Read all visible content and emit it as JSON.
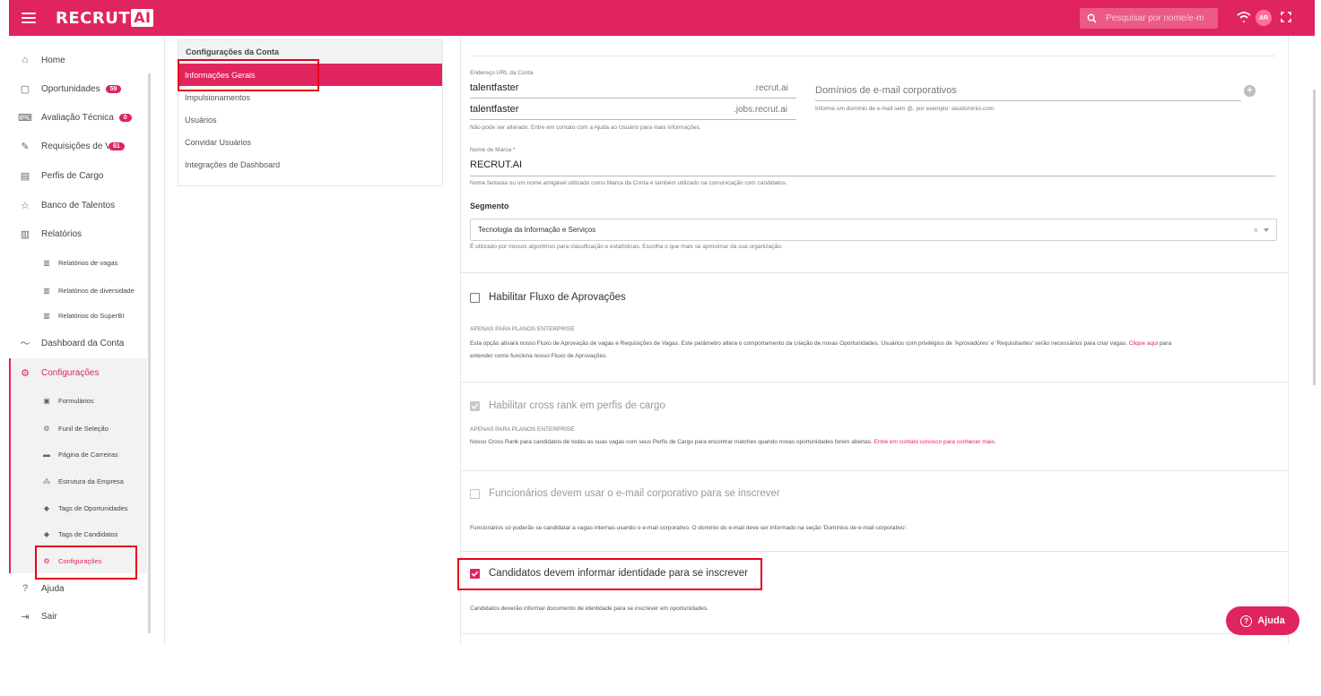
{
  "header": {
    "logo_text": "RECRUT",
    "logo_ai": "AI",
    "search_placeholder": "Pesquisar por nome/e-m",
    "avatar_initials": "AR"
  },
  "sidebar": {
    "home": "Home",
    "oportunidades": "Oportunidades",
    "oportunidades_count": "59",
    "avaliacao": "Avaliação Técnica",
    "avaliacao_count": "0",
    "requisicoes": "Requisições de Vagas",
    "requisicoes_count": "61",
    "perfis": "Perfis de Cargo",
    "banco": "Banco de Talentos",
    "relatorios": "Relatórios",
    "rel_vagas": "Relatórios de vagas",
    "rel_diversidade": "Relatórios de diversidade",
    "rel_superbi": "Relatórios do SuperBI",
    "dashboard": "Dashboard da Conta",
    "configuracoes": "Configurações",
    "formularios": "Formulários",
    "funil": "Funil de Seleção",
    "pagina_carreiras": "Página de Carreiras",
    "estrutura": "Estrutura da Empresa",
    "tags_oport": "Tags de Oportunidades",
    "tags_cand": "Tags de Candidatos",
    "config_sub": "Configurações",
    "ajuda": "Ajuda",
    "sair": "Sair"
  },
  "panel": {
    "title": "Configurações da Conta",
    "items": [
      "Informações Gerais",
      "Impulsionamentos",
      "Usuários",
      "Convidar Usuários",
      "Integrações de Dashboard"
    ]
  },
  "form": {
    "url_label": "Endereço URL da Conta",
    "url_value_1": "talentfaster",
    "url_suffix_1": ".recrut.ai",
    "url_value_2": "talentfaster",
    "url_suffix_2": ".jobs.recrut.ai",
    "url_hint": "Não pode ser alterado. Entre em contato com a Ajuda ao Usuário para mais informações.",
    "domains_placeholder": "Domínios de e-mail corporativos",
    "domains_hint": "Informe um domínio de e-mail sem @, por exemplo: seudominio.com",
    "brand_label": "Nome de Marca *",
    "brand_value": "RECRUT.AI",
    "brand_hint": "Nome fantasia ou um nome amigável utilizado como Marca da Conta e também utilizado na comunicação com candidatos.",
    "segment_label": "Segmento",
    "segment_value": "Tecnologia da Informação e Serviços",
    "segment_hint": "É utilizado por nossos algoritmos para classificação e estatísticas. Escolha o que mais se aproximar da sua organização."
  },
  "options": {
    "approval_label": "Habilitar Fluxo de Aprovações",
    "approval_tag": "APENAS PARA PLANOS ENTERPRISE",
    "approval_desc": "Esta opção ativará nosso Fluxo de Aprovação de vagas e Requisições de Vagas. Este parâmetro altera o comportamento da criação de novas Oportunidades. Usuários com privilégios de 'Aprovadores' e 'Requisitantes' serão necessários para criar vagas.",
    "approval_link": "Clique aqui",
    "approval_desc_2": "para",
    "approval_desc_3": "entender como funciona nosso Fluxo de Aprovações.",
    "crossrank_label": "Habilitar cross rank em perfis de cargo",
    "crossrank_tag": "APENAS PARA PLANOS ENTERPRISE",
    "crossrank_desc": "Nosso Cross Rank para candidatos de todas as suas vagas com seus Perfis de Cargo para encontrar matches quando novas oportunidades forem abertas.",
    "crossrank_link": "Entre em contato conosco para conhecer mais.",
    "employees_label": "Funcionários devem usar o e-mail corporativo para se inscrever",
    "employees_desc": "Funcionários só poderão se candidatar a vagas internas usando o e-mail corporativo. O domínio do e-mail deve ser informado na seção 'Domínios de e-mail corporativo'.",
    "identity_label": "Candidatos devem informar identidade para se inscrever",
    "identity_desc": "Candidatos deverão informar documento de identidade para se inscrever em oportunidades."
  },
  "help_button": "Ajuda",
  "colors": {
    "brand": "#e0245e",
    "highlight_box": "#e8001c"
  }
}
